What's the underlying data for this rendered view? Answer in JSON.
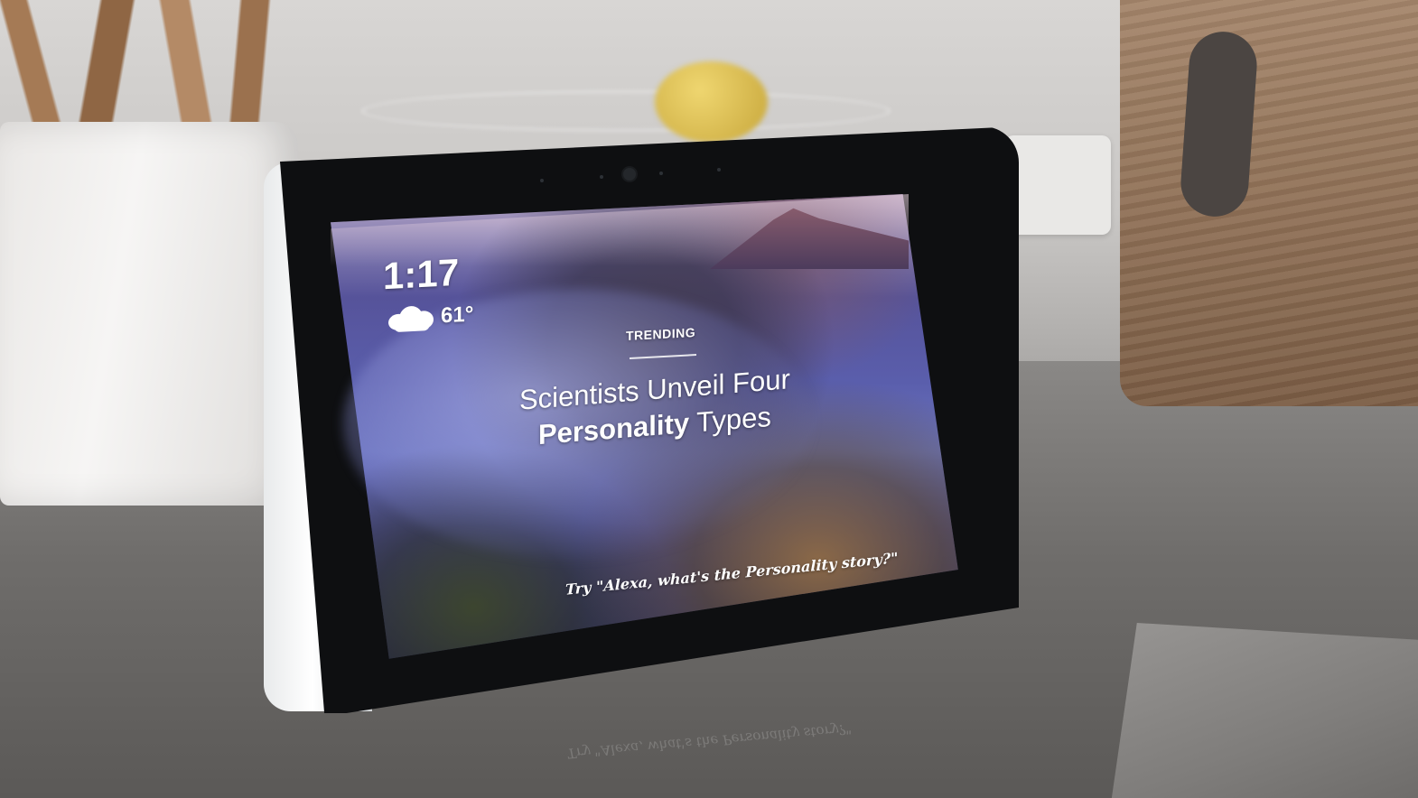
{
  "device_screen": {
    "clock": "1:17",
    "temperature": "61°",
    "weather_icon": "cloud-icon",
    "section_label": "TRENDING",
    "headline_line1": "Scientists Unveil Four",
    "headline_bold": "Personality",
    "headline_rest": "Types",
    "voice_hint": "Try \"Alexa, what's the Personality story?\""
  },
  "counter_reflection": {
    "text": "Try \"Alexa, what's the Personality story?\""
  }
}
